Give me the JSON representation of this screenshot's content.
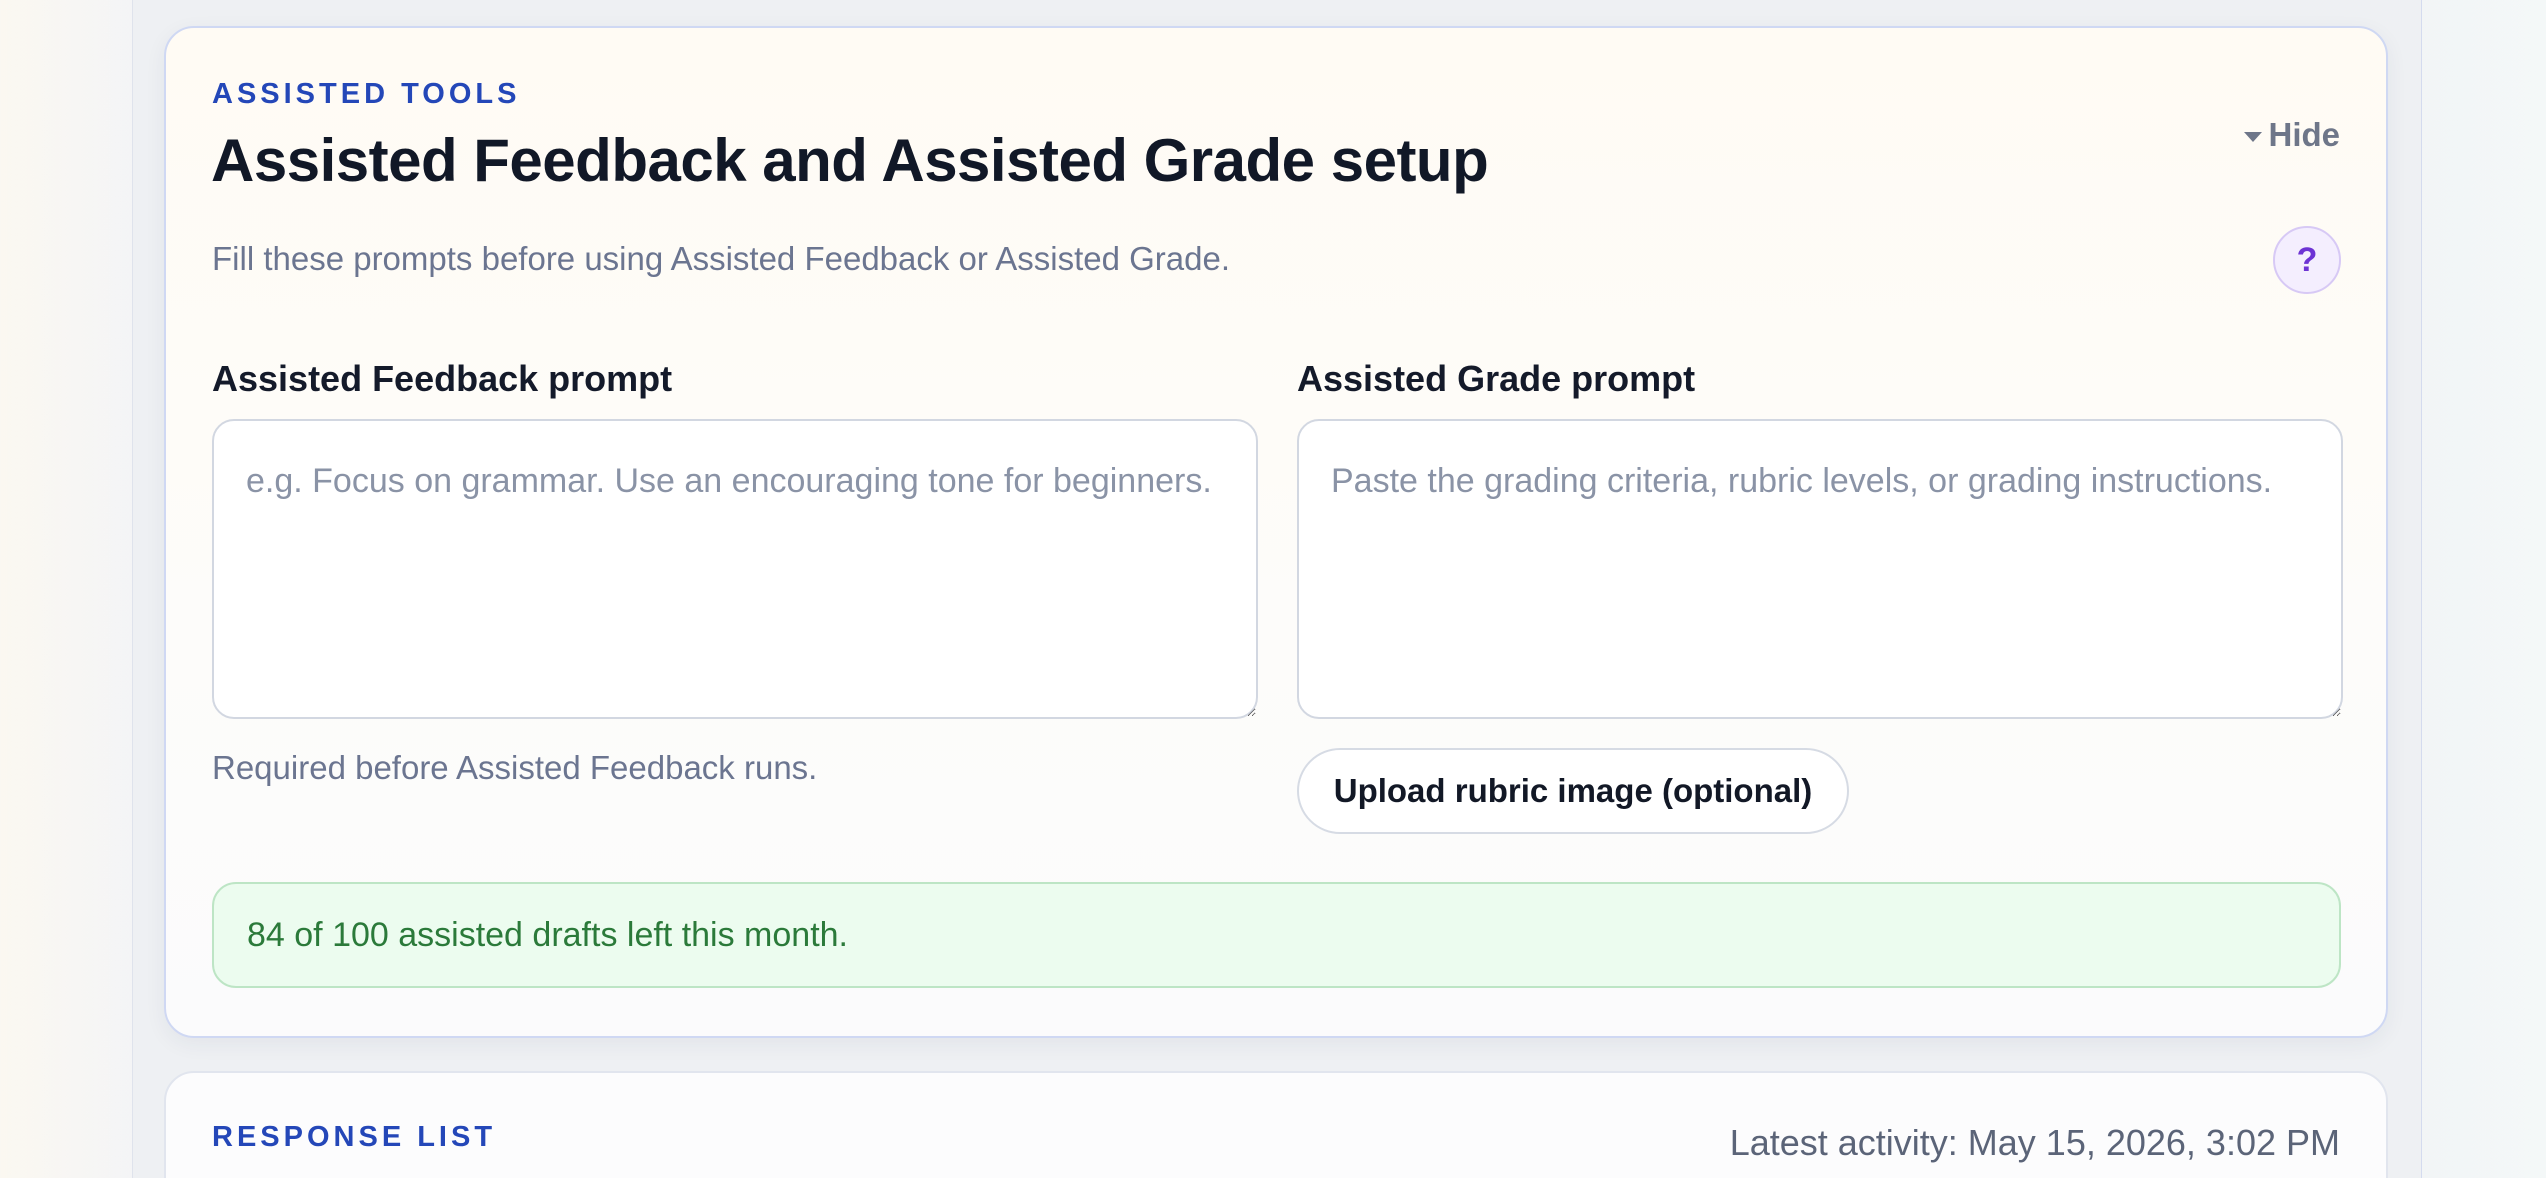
{
  "assisted_tools": {
    "eyebrow": "ASSISTED TOOLS",
    "title": "Assisted Feedback and Assisted Grade setup",
    "subtitle": "Fill these prompts before using Assisted Feedback or Assisted Grade.",
    "hide_label": "Hide",
    "help_label": "?",
    "feedback": {
      "label": "Assisted Feedback prompt",
      "value": "",
      "placeholder": "e.g. Focus on grammar. Use an encouraging tone for beginners.",
      "helper": "Required before Assisted Feedback runs."
    },
    "grade": {
      "label": "Assisted Grade prompt",
      "value": "",
      "placeholder": "Paste the grading criteria, rubric levels, or grading instructions.",
      "upload_label": "Upload rubric image (optional)"
    },
    "quota": {
      "text": "84 of 100 assisted drafts left this month.",
      "used_fraction": 0.16
    }
  },
  "response_list": {
    "eyebrow": "RESPONSE LIST",
    "latest_activity": "Latest activity: May 15, 2026, 3:02 PM"
  },
  "colors": {
    "accent": "#2447b8",
    "title": "#111827",
    "help_purple": "#6d33d4",
    "success_bg": "#ecfcef",
    "success_text": "#2b7a3a"
  },
  "icons": {
    "hide_toggle": "caret-down-icon",
    "help": "question-mark-icon"
  }
}
